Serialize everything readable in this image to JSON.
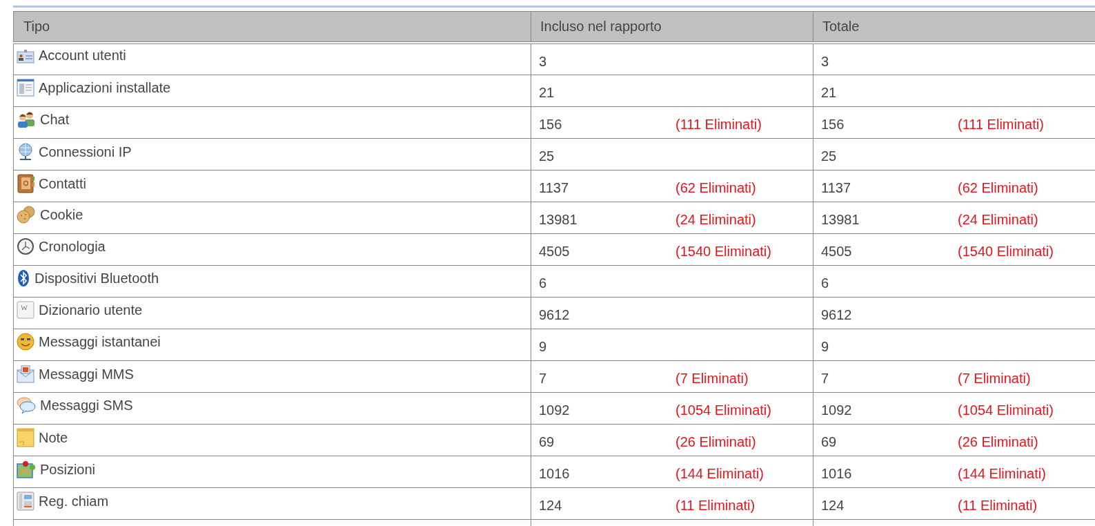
{
  "table": {
    "columns": [
      "Tipo",
      "Incluso nel rapporto",
      "Totale"
    ],
    "rows": [
      {
        "type": "Account utenti",
        "included": "3",
        "total": "3"
      },
      {
        "type": "Applicazioni installate",
        "included": "21",
        "total": "21"
      },
      {
        "type": "Chat",
        "included": "156",
        "included_deleted": "(111 Eliminati)",
        "total": "156",
        "total_deleted": "(111 Eliminati)"
      },
      {
        "type": "Connessioni IP",
        "included": "25",
        "total": "25"
      },
      {
        "type": "Contatti",
        "included": "1137",
        "included_deleted": "(62 Eliminati)",
        "total": "1137",
        "total_deleted": "(62 Eliminati)"
      },
      {
        "type": "Cookie",
        "included": "13981",
        "included_deleted": "(24 Eliminati)",
        "total": "13981",
        "total_deleted": "(24 Eliminati)"
      },
      {
        "type": "Cronologia",
        "included": "4505",
        "included_deleted": "(1540 Eliminati)",
        "total": "4505",
        "total_deleted": "(1540 Eliminati)"
      },
      {
        "type": "Dispositivi Bluetooth",
        "included": "6",
        "total": "6"
      },
      {
        "type": "Dizionario utente",
        "included": "9612",
        "total": "9612"
      },
      {
        "type": "Messaggi istantanei",
        "included": "9",
        "total": "9"
      },
      {
        "type": "Messaggi MMS",
        "included": "7",
        "included_deleted": "(7 Eliminati)",
        "total": "7",
        "total_deleted": "(7 Eliminati)"
      },
      {
        "type": "Messaggi SMS",
        "included": "1092",
        "included_deleted": "(1054 Eliminati)",
        "total": "1092",
        "total_deleted": "(1054 Eliminati)"
      },
      {
        "type": "Note",
        "included": "69",
        "included_deleted": "(26 Eliminati)",
        "total": "69",
        "total_deleted": "(26 Eliminati)"
      },
      {
        "type": "Posizioni",
        "included": "1016",
        "included_deleted": "(144 Eliminati)",
        "total": "1016",
        "total_deleted": "(144 Eliminati)"
      },
      {
        "type": "Reg. chiam",
        "included": "124",
        "included_deleted": "(11 Eliminati)",
        "total": "124",
        "total_deleted": "(11 Eliminati)"
      }
    ]
  }
}
